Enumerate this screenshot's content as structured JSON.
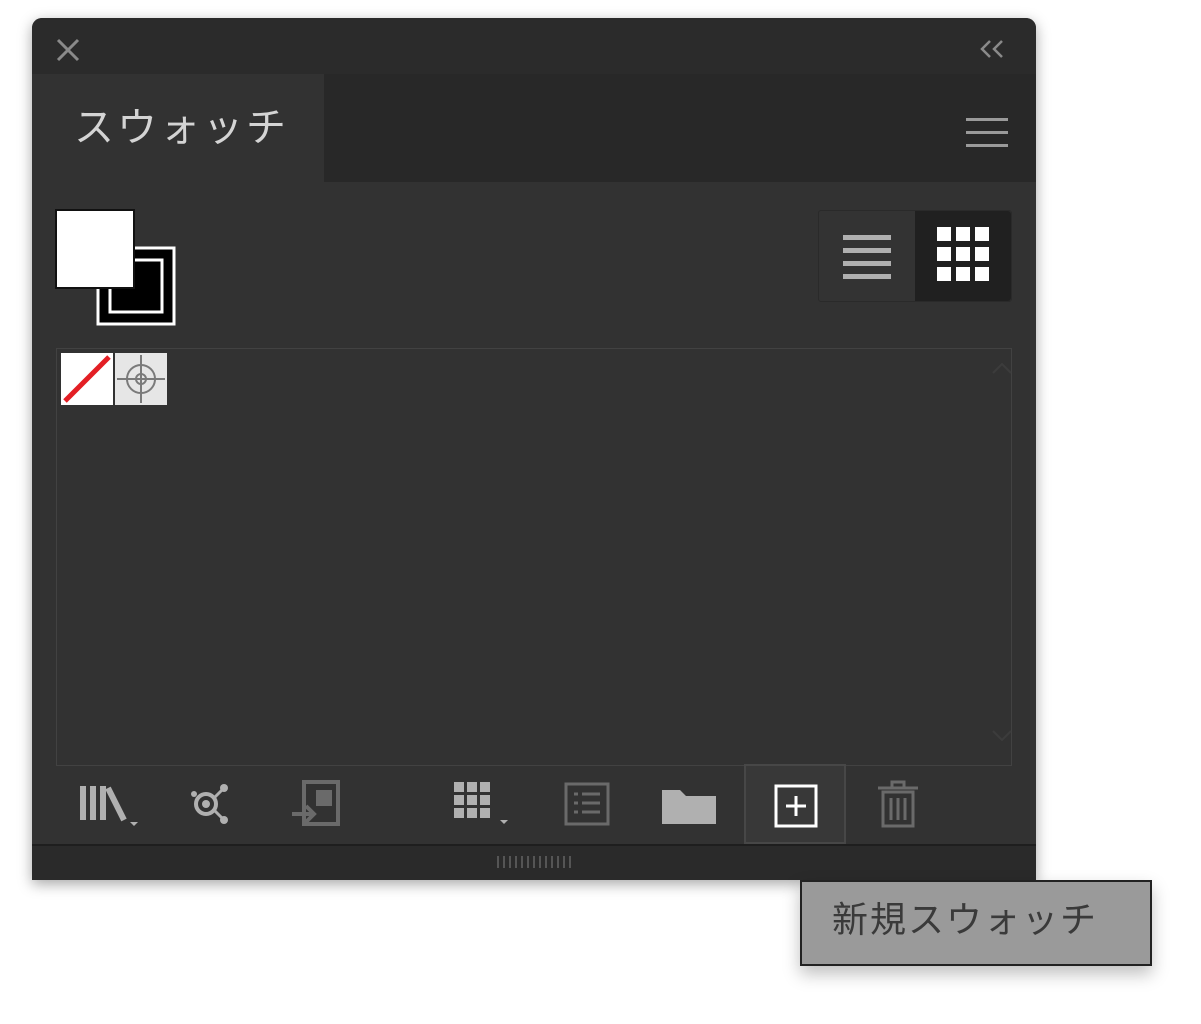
{
  "panel": {
    "tab_label": "スウォッチ",
    "view_mode": "grid"
  },
  "swatches": [
    {
      "name": "none-swatch-icon",
      "kind": "none"
    },
    {
      "name": "registration-swatch-icon",
      "kind": "registration"
    }
  ],
  "toolbar": {
    "icons": [
      "swatch-libraries-icon",
      "show-swatch-kinds-icon",
      "swatch-options-icon",
      "new-color-group-icon",
      "swatch-list-icon",
      "folder-icon",
      "new-swatch-icon",
      "trash-icon"
    ],
    "active": "new-swatch-icon"
  },
  "tooltip": {
    "text": "新規スウォッチ"
  },
  "colors": {
    "panel_bg": "#323232",
    "titlebar_bg": "#2b2b2b",
    "tab_text": "#d4d4d4",
    "none_slash": "#e31e24",
    "tooltip_bg": "#9a9a9a"
  }
}
